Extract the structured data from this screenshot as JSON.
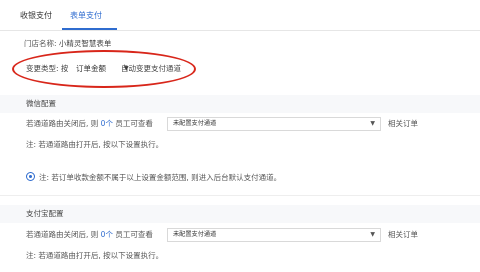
{
  "tabs": [
    {
      "label": "收银支付"
    },
    {
      "label": "表单支付"
    }
  ],
  "store": {
    "label": "门店名称:",
    "value": "小精灵智慧表单"
  },
  "change_type": {
    "label": "变更类型: 按",
    "selected": "订单金额",
    "auto_text": "自动变更支付通道"
  },
  "wechat": {
    "title": "微信配置",
    "row_prefix": "若通道路由关闭后, 则",
    "count": "0个",
    "row_mid": "员工可查看",
    "select_value": "未配置支付通道",
    "row_suffix": "相关订单",
    "note": "注: 若通道路由打开后, 按以下设置执行。",
    "info": "注: 若订单收款金额不属于以上设置金额范围, 则进入后台默认支付通道。"
  },
  "alipay": {
    "title": "支付宝配置",
    "row_prefix": "若通道路由关闭后, 则",
    "count": "0个",
    "row_mid": "员工可查看",
    "select_value": "未配置支付通道",
    "row_suffix": "相关订单",
    "note": "注: 若通道路由打开后, 按以下设置执行。"
  },
  "icons": {
    "caret": "caret-down-icon",
    "info": "info-circle-icon"
  },
  "colors": {
    "accent": "#2f6ccf",
    "annotation": "#d8261a"
  }
}
